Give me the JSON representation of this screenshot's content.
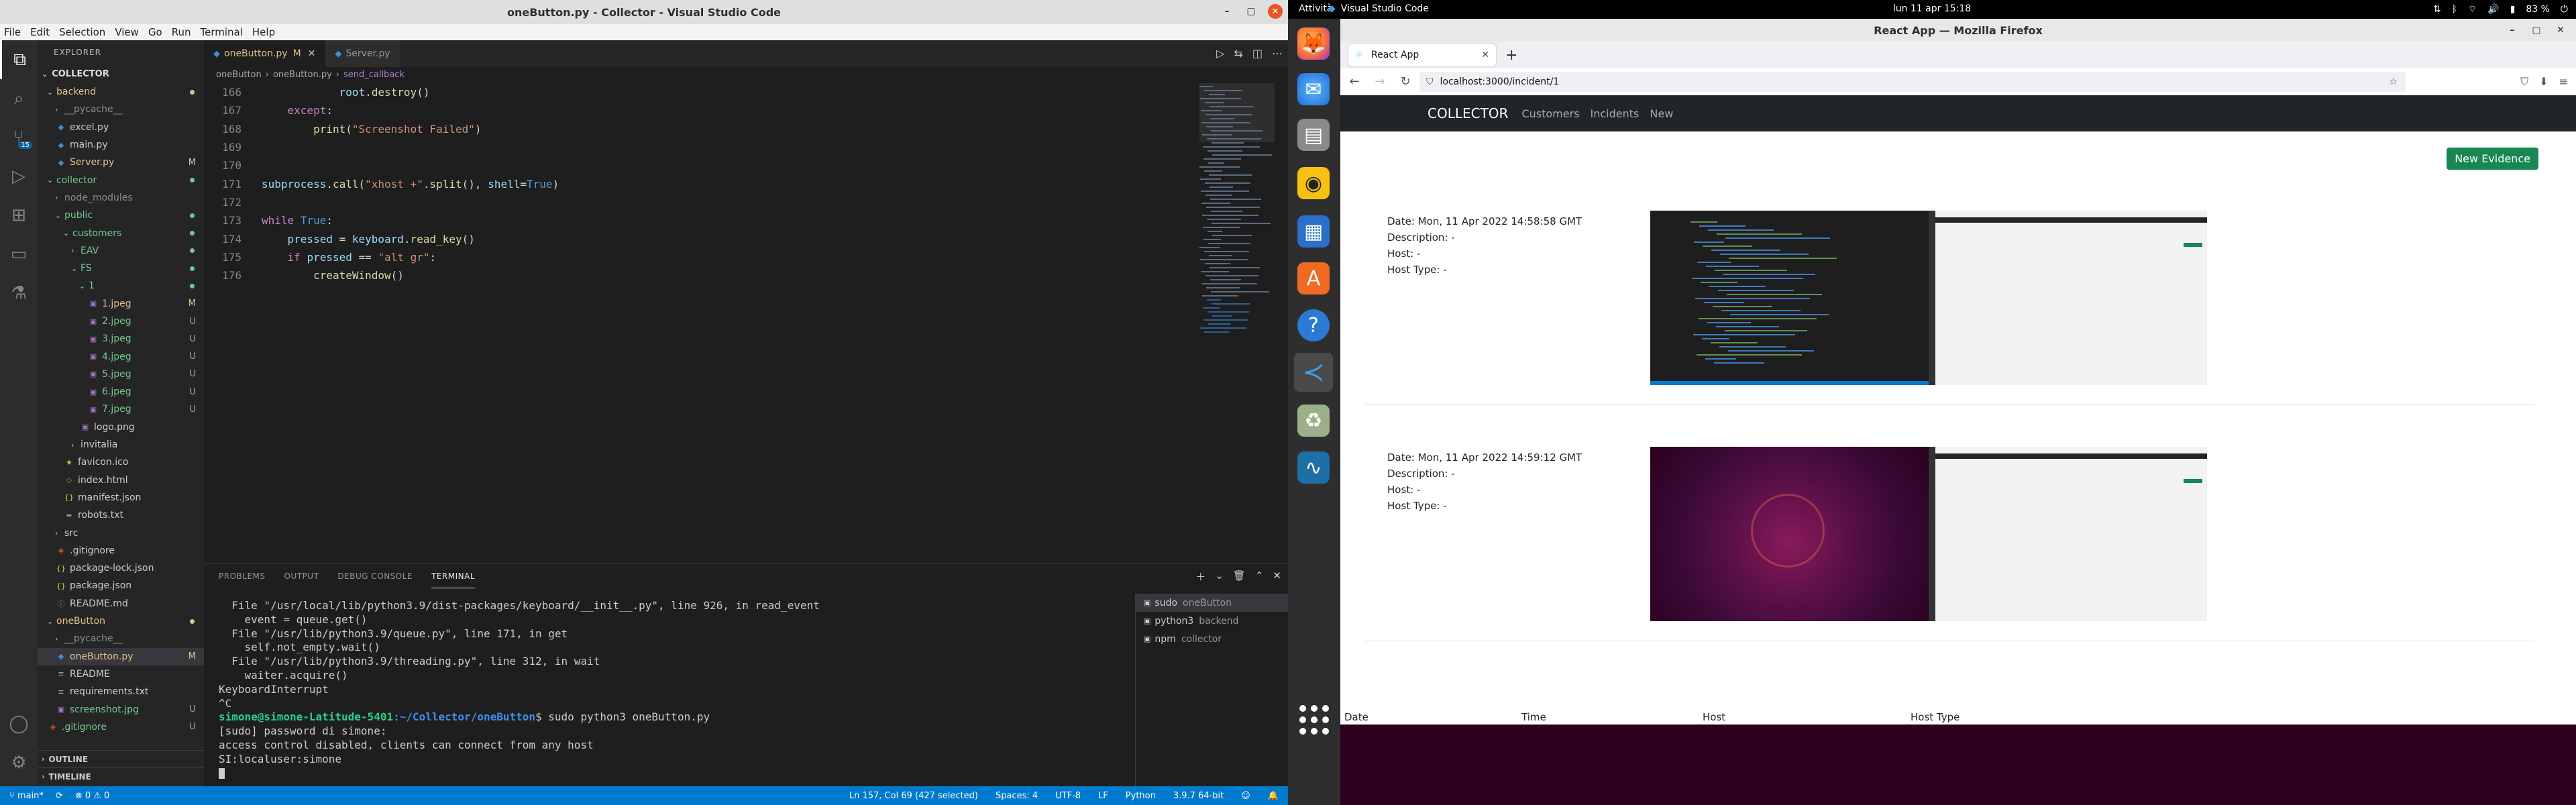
{
  "vscode": {
    "window_title": "oneButton.py - Collector - Visual Studio Code",
    "menu": [
      "File",
      "Edit",
      "Selection",
      "View",
      "Go",
      "Run",
      "Terminal",
      "Help"
    ],
    "explorer_header": "EXPLORER",
    "root_folder": "COLLECTOR",
    "scm_badge": "15",
    "tree": [
      {
        "label": "backend",
        "depth": 0,
        "kind": "folder-open",
        "status": "dot",
        "color": "mod"
      },
      {
        "label": "__pycache__",
        "depth": 1,
        "kind": "folder",
        "status": "",
        "color": "ign"
      },
      {
        "label": "excel.py",
        "depth": 1,
        "kind": "py",
        "status": "",
        "color": "def"
      },
      {
        "label": "main.py",
        "depth": 1,
        "kind": "py",
        "status": "",
        "color": "def"
      },
      {
        "label": "Server.py",
        "depth": 1,
        "kind": "py",
        "status": "M",
        "color": "mod"
      },
      {
        "label": "collector",
        "depth": 0,
        "kind": "folder-open",
        "status": "dot",
        "color": "unt"
      },
      {
        "label": "node_modules",
        "depth": 1,
        "kind": "folder",
        "status": "",
        "color": "ign"
      },
      {
        "label": "public",
        "depth": 1,
        "kind": "folder-open",
        "status": "dot",
        "color": "unt"
      },
      {
        "label": "customers",
        "depth": 2,
        "kind": "folder-open",
        "status": "dot",
        "color": "unt"
      },
      {
        "label": "EAV",
        "depth": 3,
        "kind": "folder",
        "status": "dot",
        "color": "unt"
      },
      {
        "label": "FS",
        "depth": 3,
        "kind": "folder-open",
        "status": "dot",
        "color": "unt"
      },
      {
        "label": "1",
        "depth": 4,
        "kind": "folder-open",
        "status": "dot",
        "color": "unt"
      },
      {
        "label": "1.jpeg",
        "depth": 5,
        "kind": "img",
        "status": "M",
        "color": "mod"
      },
      {
        "label": "2.jpeg",
        "depth": 5,
        "kind": "img",
        "status": "U",
        "color": "unt"
      },
      {
        "label": "3.jpeg",
        "depth": 5,
        "kind": "img",
        "status": "U",
        "color": "unt"
      },
      {
        "label": "4.jpeg",
        "depth": 5,
        "kind": "img",
        "status": "U",
        "color": "unt"
      },
      {
        "label": "5.jpeg",
        "depth": 5,
        "kind": "img",
        "status": "U",
        "color": "unt"
      },
      {
        "label": "6.jpeg",
        "depth": 5,
        "kind": "img",
        "status": "U",
        "color": "unt"
      },
      {
        "label": "7.jpeg",
        "depth": 5,
        "kind": "img",
        "status": "U",
        "color": "unt"
      },
      {
        "label": "logo.png",
        "depth": 4,
        "kind": "img",
        "status": "",
        "color": "def"
      },
      {
        "label": "invitalia",
        "depth": 3,
        "kind": "folder",
        "status": "",
        "color": "def"
      },
      {
        "label": "favicon.ico",
        "depth": 2,
        "kind": "star",
        "status": "",
        "color": "def"
      },
      {
        "label": "index.html",
        "depth": 2,
        "kind": "html",
        "status": "",
        "color": "def"
      },
      {
        "label": "manifest.json",
        "depth": 2,
        "kind": "json",
        "status": "",
        "color": "def"
      },
      {
        "label": "robots.txt",
        "depth": 2,
        "kind": "txt",
        "status": "",
        "color": "def"
      },
      {
        "label": "src",
        "depth": 1,
        "kind": "folder",
        "status": "",
        "color": "def"
      },
      {
        "label": ".gitignore",
        "depth": 1,
        "kind": "git",
        "status": "",
        "color": "def"
      },
      {
        "label": "package-lock.json",
        "depth": 1,
        "kind": "json",
        "status": "",
        "color": "def"
      },
      {
        "label": "package.json",
        "depth": 1,
        "kind": "json",
        "status": "",
        "color": "def"
      },
      {
        "label": "README.md",
        "depth": 1,
        "kind": "md",
        "status": "",
        "color": "def"
      },
      {
        "label": "oneButton",
        "depth": 0,
        "kind": "folder-open",
        "status": "dot",
        "color": "mod"
      },
      {
        "label": "__pycache__",
        "depth": 1,
        "kind": "folder",
        "status": "",
        "color": "ign"
      },
      {
        "label": "oneButton.py",
        "depth": 1,
        "kind": "py",
        "status": "M",
        "color": "mod",
        "selected": true
      },
      {
        "label": "README",
        "depth": 1,
        "kind": "txt",
        "status": "",
        "color": "def"
      },
      {
        "label": "requirements.txt",
        "depth": 1,
        "kind": "txt",
        "status": "",
        "color": "def"
      },
      {
        "label": "screenshot.jpg",
        "depth": 1,
        "kind": "img",
        "status": "U",
        "color": "unt"
      },
      {
        "label": ".gitignore",
        "depth": 0,
        "kind": "git",
        "status": "U",
        "color": "unt"
      }
    ],
    "outline_label": "OUTLINE",
    "timeline_label": "TIMELINE",
    "tabs": [
      {
        "label": "oneButton.py",
        "mark": "M",
        "active": true
      },
      {
        "label": "Server.py",
        "mark": "",
        "active": false
      }
    ],
    "breadcrumb": [
      "oneButton",
      "›",
      "oneButton.py",
      "›",
      "send_callback"
    ],
    "code": [
      {
        "n": "166",
        "html": "            <span class='v'>root</span>.<span class='f'>destroy</span>()"
      },
      {
        "n": "167",
        "html": "    <span class='k'>except</span>:"
      },
      {
        "n": "168",
        "html": "        <span class='f'>print</span>(<span class='s'>\"Screenshot Failed\"</span>)"
      },
      {
        "n": "169",
        "html": ""
      },
      {
        "n": "170",
        "html": ""
      },
      {
        "n": "171",
        "html": "<span class='v'>subprocess</span>.<span class='f'>call</span>(<span class='s'>\"xhost +\"</span>.<span class='f'>split</span>(), <span class='v'>shell</span>=<span class='b'>True</span>)"
      },
      {
        "n": "172",
        "html": ""
      },
      {
        "n": "173",
        "html": "<span class='k'>while</span> <span class='b'>True</span>:"
      },
      {
        "n": "174",
        "html": "    <span class='v'>pressed</span> = <span class='v'>keyboard</span>.<span class='f'>read_key</span>()"
      },
      {
        "n": "175",
        "html": "    <span class='k'>if</span> <span class='v'>pressed</span> == <span class='s'>\"alt gr\"</span>:"
      },
      {
        "n": "176",
        "html": "        <span class='f'>createWindow</span>()"
      }
    ],
    "panel_tabs": [
      "PROBLEMS",
      "OUTPUT",
      "DEBUG CONSOLE",
      "TERMINAL"
    ],
    "terminal_lines": [
      {
        "text": "  File \"/usr/local/lib/python3.9/dist-packages/keyboard/__init__.py\", line 926, in read_event"
      },
      {
        "text": "    event = queue.get()"
      },
      {
        "text": "  File \"/usr/lib/python3.9/queue.py\", line 171, in get"
      },
      {
        "text": "    self.not_empty.wait()"
      },
      {
        "text": "  File \"/usr/lib/python3.9/threading.py\", line 312, in wait"
      },
      {
        "text": "    waiter.acquire()"
      },
      {
        "text": "KeyboardInterrupt"
      },
      {
        "text": "^C"
      },
      {
        "prompt_user": "simone@simone-Latitude-5401",
        "prompt_path": ":~/Collector/oneButton",
        "text": "$ sudo python3 oneButton.py"
      },
      {
        "text": "[sudo] password di simone:"
      },
      {
        "text": "access control disabled, clients can connect from any host"
      },
      {
        "text": "SI:localuser:simone"
      }
    ],
    "terminals": [
      {
        "name": "sudo",
        "tag": "oneButton",
        "active": true
      },
      {
        "name": "python3",
        "tag": "backend",
        "active": false
      },
      {
        "name": "npm",
        "tag": "collector",
        "active": false
      }
    ],
    "status_left": [
      "main*",
      "⊗ 0 ⚠ 0"
    ],
    "status_right": [
      "Ln 157, Col 69 (427 selected)",
      "Spaces: 4",
      "UTF-8",
      "LF",
      "Python",
      "3.9.7 64-bit"
    ]
  },
  "ubuntu": {
    "activities": "Attività",
    "app_name": "Visual Studio Code",
    "clock": "lun 11 apr  15:18",
    "battery": "83 %",
    "firefox_title": "React App — Mozilla Firefox",
    "tab_title": "React App",
    "url": "localhost:3000/incident/1",
    "brand": "COLLECTOR",
    "nav_links": [
      "Customers",
      "Incidents",
      "New"
    ],
    "new_evidence_label": "New Evidence",
    "incidents": [
      {
        "date": "Date: Mon, 11 Apr 2022 14:58:58 GMT",
        "description": "Description: -",
        "host": "Host: -",
        "host_type": "Host Type: -",
        "left_theme": "code"
      },
      {
        "date": "Date: Mon, 11 Apr 2022 14:59:12 GMT",
        "description": "Description: -",
        "host": "Host: -",
        "host_type": "Host Type: -",
        "left_theme": "wallpaper"
      }
    ],
    "table_headers": [
      "Date",
      "Time",
      "Host",
      "Host Type"
    ]
  },
  "colors": {
    "vscode_blue": "#007acc",
    "ubuntu_orange": "#e95420",
    "bootstrap_green": "#198754",
    "navbar_dark": "#212529",
    "ubuntu_aubergine": "#2c001e"
  }
}
